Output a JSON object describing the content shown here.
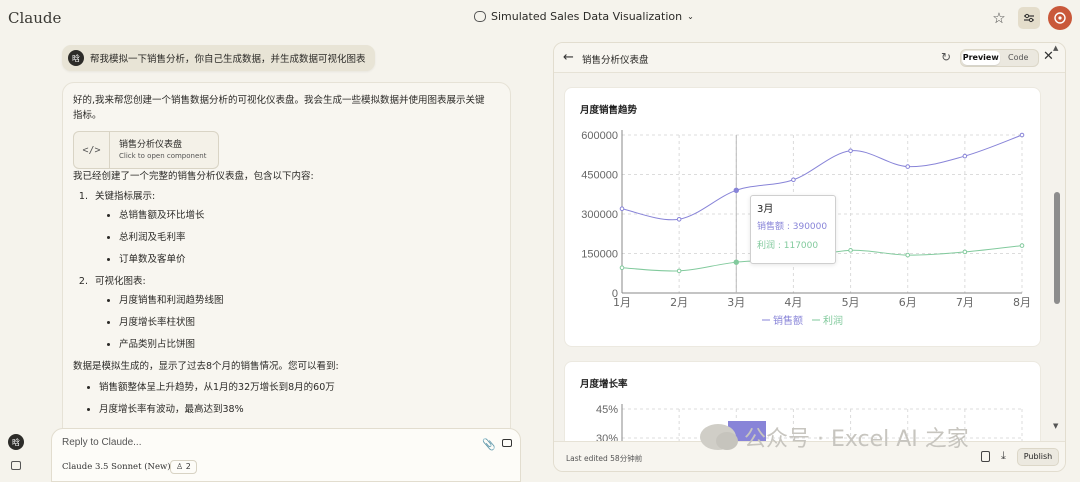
{
  "app": {
    "brand": "Claude",
    "conversation_title": "Simulated Sales Data Visualization"
  },
  "user": {
    "avatar_initial": "晗"
  },
  "user_message": "帮我模拟一下销售分析，你自己生成数据，并生成数据可视化图表",
  "assistant": {
    "intro": "好的,我来帮您创建一个销售数据分析的可视化仪表盘。我会生成一些模拟数据并使用图表展示关键指标。",
    "artifact": {
      "title": "销售分析仪表盘",
      "subtitle": "Click to open component"
    },
    "summary": "我已经创建了一个完整的销售分析仪表盘，包含以下内容:",
    "sections": [
      {
        "title": "关键指标展示:",
        "items": [
          "总销售额及环比增长",
          "总利润及毛利率",
          "订单数及客单价"
        ]
      },
      {
        "title": "可视化图表:",
        "items": [
          "月度销售和利润趋势线图",
          "月度增长率柱状图",
          "产品类别占比饼图"
        ]
      }
    ],
    "data_note": "数据是模拟生成的，显示了过去8个月的销售情况。您可以看到:",
    "observations": [
      "销售额整体呈上升趋势，从1月的32万增长到8月的60万",
      "月度增长率有波动，最高达到38%"
    ]
  },
  "composer": {
    "placeholder": "Reply to Claude...",
    "model": "Claude 3.5 Sonnet (New)",
    "style_count": "2"
  },
  "panel": {
    "title": "销售分析仪表盘",
    "tabs": {
      "preview": "Preview",
      "code": "Code"
    },
    "last_edited": "Last edited 58分钟前",
    "publish": "Publish"
  },
  "chart_data": [
    {
      "type": "line",
      "title": "月度销售趋势",
      "categories": [
        "1月",
        "2月",
        "3月",
        "4月",
        "5月",
        "6月",
        "7月",
        "8月"
      ],
      "series": [
        {
          "name": "销售额",
          "color": "#8884d8",
          "values": [
            320000,
            280000,
            390000,
            430000,
            540000,
            480000,
            520000,
            600000
          ]
        },
        {
          "name": "利润",
          "color": "#82ca9d",
          "values": [
            96000,
            84000,
            117000,
            129000,
            162000,
            144000,
            156000,
            180000
          ]
        }
      ],
      "y_ticks": [
        "0",
        "150000",
        "300000",
        "450000",
        "600000"
      ],
      "ylim": [
        0,
        600000
      ],
      "grid": true,
      "legend": "bottom",
      "tooltip": {
        "label": "3月",
        "line1": "销售额 : 390000",
        "line2": "利润 : 117000"
      }
    },
    {
      "type": "bar",
      "title": "月度增长率",
      "y_ticks": [
        "45%",
        "30%"
      ],
      "bar_color": "#8884d8"
    }
  ],
  "watermark": "公众号 · Excel AI 之家"
}
